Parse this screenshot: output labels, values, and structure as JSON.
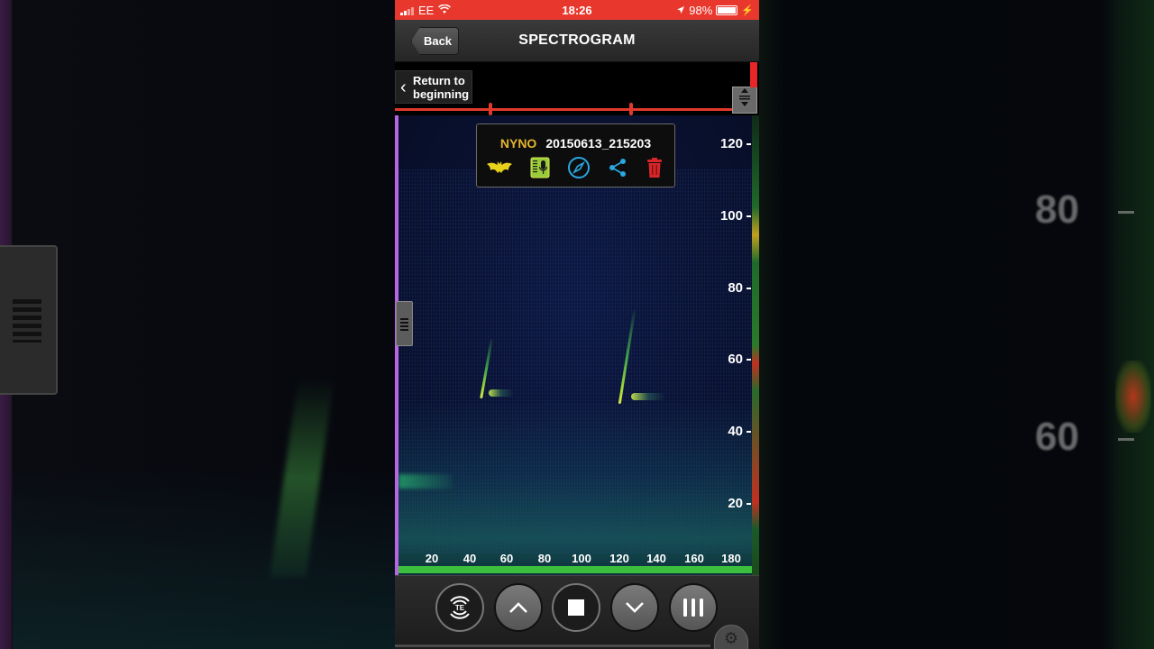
{
  "status_bar": {
    "carrier": "EE",
    "time": "18:26",
    "battery": "98%",
    "battery_level": 0.98
  },
  "nav": {
    "back_label": "Back",
    "title": "SPECTROGRAM"
  },
  "waveform": {
    "return_label_line1": "Return to",
    "return_label_line2": "beginning"
  },
  "recording": {
    "species": "NYNO",
    "filename": "20150613_215203"
  },
  "icons": {
    "bat": "bat-icon",
    "audio_file": "audio-file-icon",
    "compass": "compass-icon",
    "share": "share-icon",
    "trash": "trash-icon",
    "gear": "gear-icon"
  },
  "axes": {
    "y_ticks": [
      "120",
      "100",
      "80",
      "60",
      "40",
      "20"
    ],
    "x_ticks": [
      "20",
      "40",
      "60",
      "80",
      "100",
      "120",
      "140",
      "160",
      "180"
    ]
  },
  "background": {
    "y_labels": [
      "80",
      "60"
    ]
  },
  "controls": {
    "te_label": "TE"
  },
  "colors": {
    "status_red": "#e8382e",
    "species_yellow": "#e4b430",
    "baseline_green": "#3cbf3c",
    "position_purple": "#b566e0",
    "waveform_red": "#e23a2a"
  }
}
